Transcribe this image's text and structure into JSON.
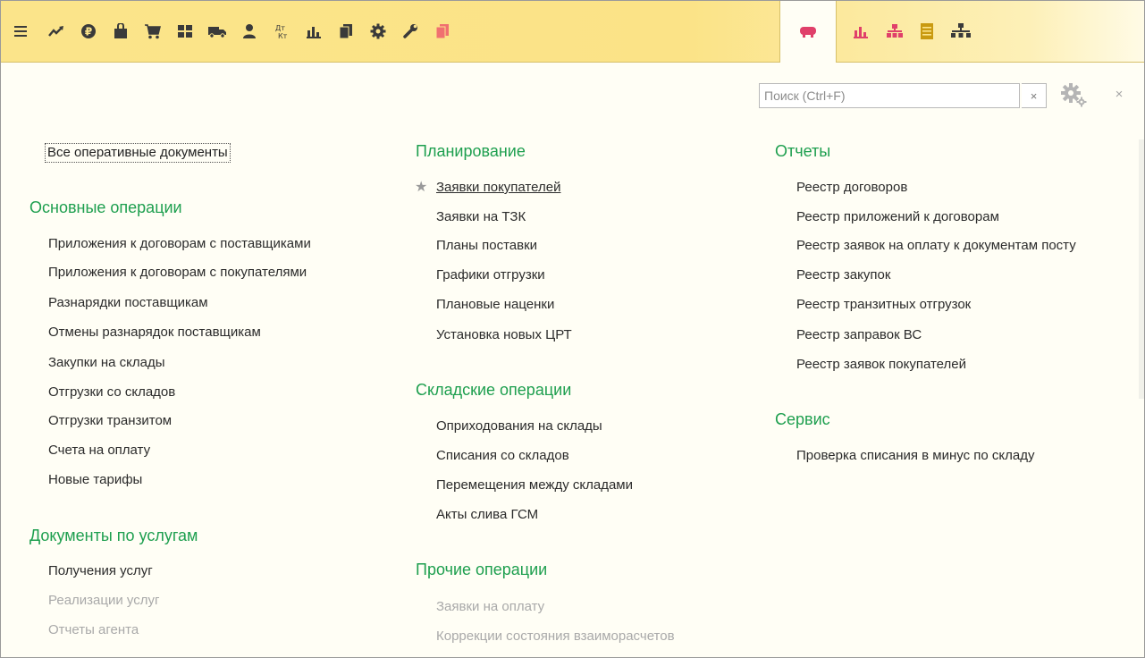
{
  "toolbar": {
    "icons": [
      {
        "name": "menu-icon",
        "color": "#3a3a3a"
      },
      {
        "name": "trend-icon",
        "color": "#3a3a3a"
      },
      {
        "name": "ruble-icon",
        "color": "#3a3a3a"
      },
      {
        "name": "bag-icon",
        "color": "#3a3a3a"
      },
      {
        "name": "cart-icon",
        "color": "#3a3a3a"
      },
      {
        "name": "grid-icon",
        "color": "#3a3a3a"
      },
      {
        "name": "truck-icon",
        "color": "#3a3a3a"
      },
      {
        "name": "user-icon",
        "color": "#3a3a3a"
      },
      {
        "name": "dt-kt-icon",
        "color": "#3a3a3a"
      },
      {
        "name": "bar-chart-icon",
        "color": "#3a3a3a"
      },
      {
        "name": "documents-icon",
        "color": "#3a3a3a"
      },
      {
        "name": "gear-icon",
        "color": "#3a3a3a"
      },
      {
        "name": "wrench-icon",
        "color": "#3a3a3a"
      },
      {
        "name": "documents-red-icon",
        "color": "#f07070"
      },
      {
        "name": "fuel-truck-icon",
        "color": "#e0406a",
        "active": true
      },
      {
        "name": "bar-chart-pink-icon",
        "color": "#e0406a"
      },
      {
        "name": "org-chart-red-icon",
        "color": "#e0406a"
      },
      {
        "name": "notepad-icon",
        "color": "#c99a10"
      },
      {
        "name": "hierarchy-icon",
        "color": "#3a3a3a"
      }
    ]
  },
  "search": {
    "placeholder": "Поиск (Ctrl+F)",
    "clear_label": "×"
  },
  "close_label": "×",
  "all_documents_label": "Все оперативные документы",
  "columns": {
    "left": {
      "sections": [
        {
          "title": "Основные операции",
          "items": [
            {
              "label": "Приложения к договорам с поставщиками"
            },
            {
              "label": "Приложения к договорам с покупателями"
            },
            {
              "label": "Разнарядки поставщикам"
            },
            {
              "label": "Отмены разнарядок поставщикам"
            },
            {
              "label": "Закупки на склады"
            },
            {
              "label": "Отгрузки со складов"
            },
            {
              "label": "Отгрузки транзитом"
            },
            {
              "label": "Счета на оплату"
            },
            {
              "label": "Новые тарифы"
            }
          ]
        },
        {
          "title": "Документы по услугам",
          "items": [
            {
              "label": "Получения услуг"
            },
            {
              "label": "Реализации услуг",
              "disabled": true
            },
            {
              "label": "Отчеты агента",
              "disabled": true
            }
          ]
        }
      ]
    },
    "middle": {
      "sections": [
        {
          "title": "Планирование",
          "items": [
            {
              "label": "Заявки покупателей",
              "starred": true
            },
            {
              "label": "Заявки на ТЗК"
            },
            {
              "label": "Планы поставки"
            },
            {
              "label": "Графики отгрузки"
            },
            {
              "label": "Плановые наценки"
            },
            {
              "label": "Установка новых ЦРТ"
            }
          ]
        },
        {
          "title": "Складские операции",
          "items": [
            {
              "label": "Оприходования на склады"
            },
            {
              "label": "Списания со складов"
            },
            {
              "label": "Перемещения между складами"
            },
            {
              "label": "Акты слива ГСМ"
            }
          ]
        },
        {
          "title": "Прочие операции",
          "items": [
            {
              "label": "Заявки на оплату",
              "disabled": true
            },
            {
              "label": "Коррекции состояния взаиморасчетов",
              "disabled": true
            }
          ]
        }
      ]
    },
    "right": {
      "sections": [
        {
          "title": "Отчеты",
          "items": [
            {
              "label": "Реестр договоров"
            },
            {
              "label": "Реестр приложений к договорам"
            },
            {
              "label": "Реестр заявок на оплату к документам посту"
            },
            {
              "label": "Реестр закупок"
            },
            {
              "label": "Реестр транзитных отгрузок"
            },
            {
              "label": "Реестр заправок ВС"
            },
            {
              "label": "Реестр заявок покупателей"
            }
          ]
        },
        {
          "title": "Сервис",
          "items": [
            {
              "label": "Проверка списания в минус по складу"
            }
          ]
        }
      ]
    }
  }
}
